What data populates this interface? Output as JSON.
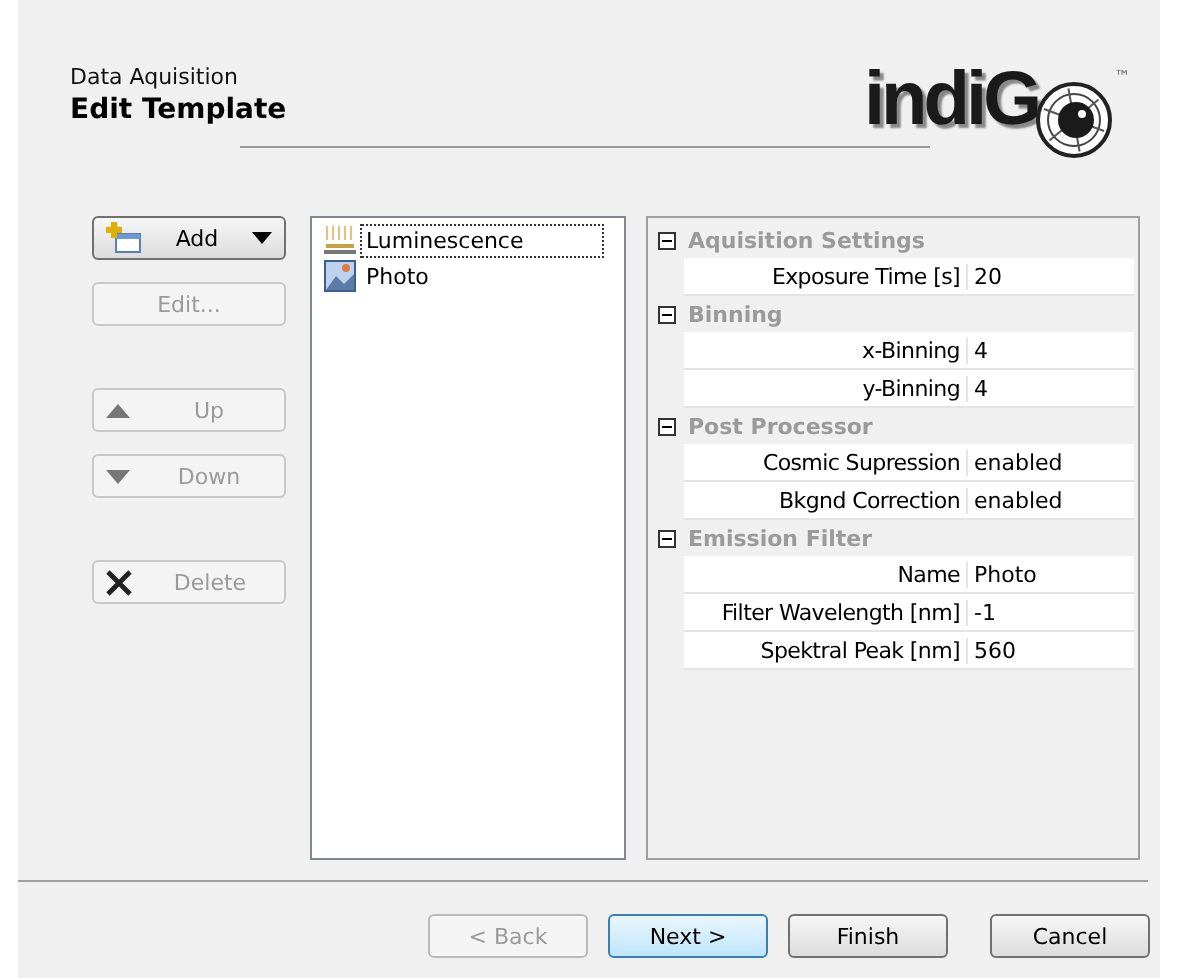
{
  "header": {
    "subtitle": "Data Aquisition",
    "title": "Edit Template"
  },
  "logo": {
    "text": "indiG",
    "trademark": "™"
  },
  "side_buttons": [
    {
      "label": "Add",
      "kind": "add",
      "disabled": false
    },
    {
      "label": "Edit...",
      "kind": "plain",
      "disabled": true
    },
    {
      "label": "Up",
      "kind": "up",
      "disabled": true
    },
    {
      "label": "Down",
      "kind": "down",
      "disabled": true
    },
    {
      "label": "Delete",
      "kind": "delete",
      "disabled": true
    }
  ],
  "templates": [
    {
      "label": "Luminescence",
      "kind": "luminescence",
      "selected": true
    },
    {
      "label": "Photo",
      "kind": "photo",
      "selected": false
    }
  ],
  "properties": [
    {
      "category": "Aquisition Settings",
      "expanded": true,
      "rows": [
        {
          "name": "Exposure Time [s]",
          "value": "20"
        }
      ]
    },
    {
      "category": "Binning",
      "expanded": true,
      "rows": [
        {
          "name": "x-Binning",
          "value": "4"
        },
        {
          "name": "y-Binning",
          "value": "4"
        }
      ]
    },
    {
      "category": "Post Processor",
      "expanded": true,
      "rows": [
        {
          "name": "Cosmic Supression",
          "value": "enabled"
        },
        {
          "name": "Bkgnd Correction",
          "value": "enabled"
        }
      ]
    },
    {
      "category": "Emission Filter",
      "expanded": true,
      "rows": [
        {
          "name": "Name",
          "value": "Photo"
        },
        {
          "name": "Filter Wavelength [nm]",
          "value": "-1"
        },
        {
          "name": "Spektral Peak [nm]",
          "value": "560"
        }
      ]
    }
  ],
  "footer_buttons": [
    {
      "label": "< Back",
      "disabled": true,
      "default": false
    },
    {
      "label": "Next >",
      "disabled": false,
      "default": true
    },
    {
      "label": "Finish",
      "disabled": false,
      "default": false
    },
    {
      "label": "Cancel",
      "disabled": false,
      "default": false
    }
  ]
}
